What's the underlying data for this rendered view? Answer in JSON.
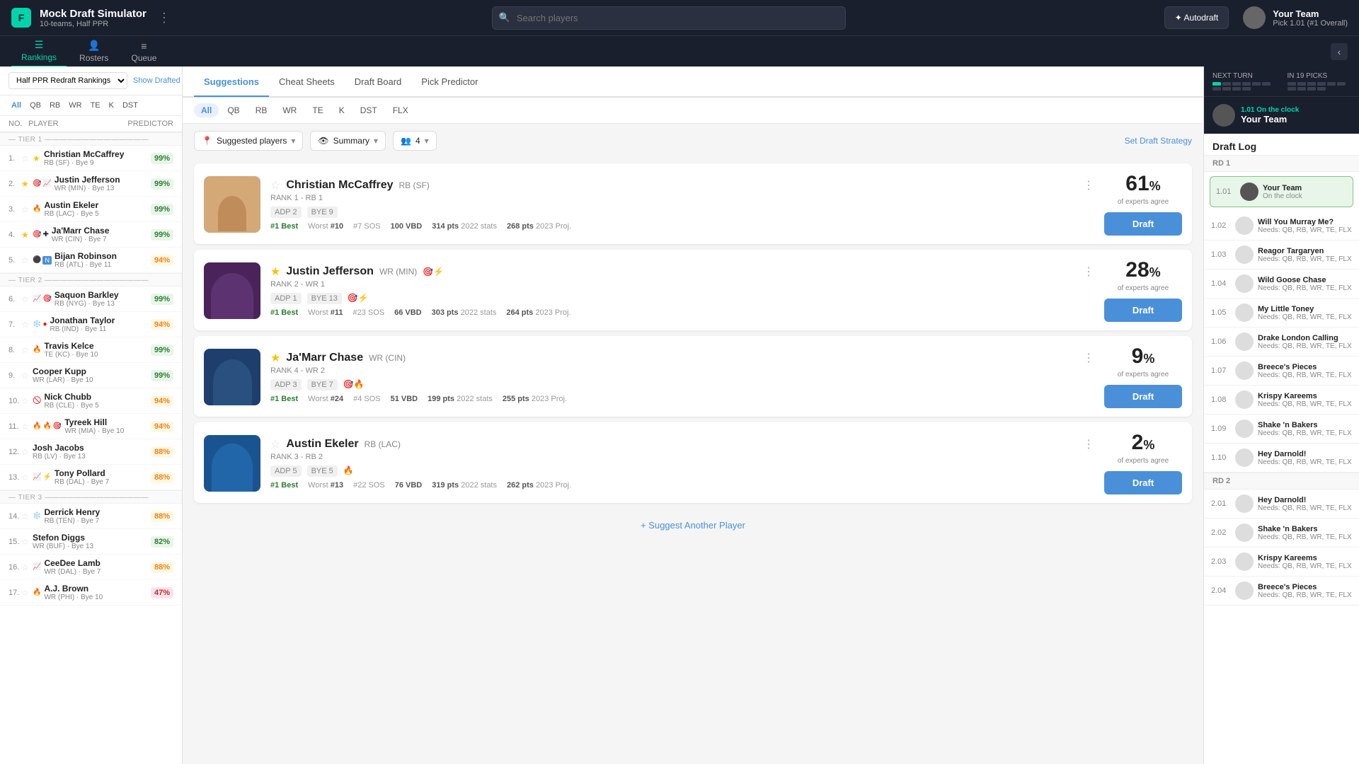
{
  "app": {
    "logo": "F",
    "title": "Mock Draft Simulator",
    "subtitle": "10-teams, Half PPR",
    "search_placeholder": "Search players",
    "autodraft_label": "✦ Autodraft",
    "your_team": {
      "name": "Your Team",
      "pick": "Pick 1.01 (#1 Overall)"
    }
  },
  "sub_nav": {
    "items": [
      {
        "id": "rankings",
        "label": "Rankings",
        "active": true
      },
      {
        "id": "rosters",
        "label": "Rosters",
        "active": false
      },
      {
        "id": "queue",
        "label": "Queue",
        "active": false
      }
    ]
  },
  "sidebar": {
    "ranking_select": "Half PPR Redraft Rankings",
    "show_drafted": "Show Drafted",
    "positions": [
      "All",
      "QB",
      "RB",
      "WR",
      "TE",
      "K",
      "DST"
    ],
    "active_position": "All",
    "table_header": {
      "no": "NO.",
      "player": "PLAYER",
      "predictor": "PREDICTOR"
    },
    "tiers": [
      {
        "label": "Tier 1",
        "players": [
          {
            "num": 1,
            "name": "Christian McCaffrey",
            "pos": "RB (SF)",
            "bye": "Bye 9",
            "score": 99,
            "starred": false,
            "icons": []
          },
          {
            "num": 2,
            "name": "Justin Jefferson",
            "pos": "WR (MIN)",
            "bye": "Bye 13",
            "score": 99,
            "starred": true,
            "icons": [
              "target",
              "trending-up"
            ]
          },
          {
            "num": 3,
            "name": "Austin Ekeler",
            "pos": "RB (LAC)",
            "bye": "Bye 5",
            "score": 99,
            "starred": false,
            "icons": [
              "fire"
            ]
          },
          {
            "num": 4,
            "name": "Ja'Marr Chase",
            "pos": "WR (CIN)",
            "bye": "Bye 7",
            "score": 99,
            "starred": false,
            "icons": [
              "target",
              "cross"
            ]
          },
          {
            "num": 5,
            "name": "Bijan Robinson",
            "pos": "RB (ATL)",
            "bye": "Bye 11",
            "score": 94,
            "starred": false,
            "icons": [
              "circle",
              "new"
            ]
          }
        ]
      },
      {
        "label": "Tier 2",
        "players": [
          {
            "num": 6,
            "name": "Saquon Barkley",
            "pos": "RB (NYG)",
            "bye": "Bye 13",
            "score": 99,
            "starred": false,
            "icons": [
              "up",
              "target"
            ]
          },
          {
            "num": 7,
            "name": "Jonathan Taylor",
            "pos": "RB (IND)",
            "bye": "Bye 11",
            "score": 94,
            "starred": false,
            "icons": [
              "snowflake",
              "dot-red"
            ]
          },
          {
            "num": 8,
            "name": "Travis Kelce",
            "pos": "TE (KC)",
            "bye": "Bye 10",
            "score": 99,
            "starred": false,
            "icons": [
              "fire"
            ]
          },
          {
            "num": 9,
            "name": "Cooper Kupp",
            "pos": "WR (LAR)",
            "bye": "Bye 10",
            "score": 99,
            "starred": false,
            "icons": []
          },
          {
            "num": 10,
            "name": "Nick Chubb",
            "pos": "RB (CLE)",
            "bye": "Bye 5",
            "score": 94,
            "starred": false,
            "icons": [
              "block"
            ]
          },
          {
            "num": 11,
            "name": "Tyreek Hill",
            "pos": "WR (MIA)",
            "bye": "Bye 10",
            "score": 94,
            "starred": false,
            "icons": [
              "fire",
              "fire",
              "target"
            ]
          },
          {
            "num": 12,
            "name": "Josh Jacobs",
            "pos": "RB (LV)",
            "bye": "Bye 13",
            "score": 88,
            "starred": false,
            "icons": []
          },
          {
            "num": 13,
            "name": "Tony Pollard",
            "pos": "RB (DAL)",
            "bye": "Bye 7",
            "score": 88,
            "starred": false,
            "icons": [
              "up",
              "trending"
            ]
          }
        ]
      },
      {
        "label": "Tier 3",
        "players": [
          {
            "num": 14,
            "name": "Derrick Henry",
            "pos": "RB (TEN)",
            "bye": "Bye 7",
            "score": 88,
            "starred": false,
            "icons": [
              "snowflake"
            ]
          },
          {
            "num": 15,
            "name": "Stefon Diggs",
            "pos": "WR (BUF)",
            "bye": "Bye 13",
            "score": 82,
            "starred": false,
            "icons": []
          },
          {
            "num": 16,
            "name": "CeeDee Lamb",
            "pos": "WR (DAL)",
            "bye": "Bye 7",
            "score": 88,
            "starred": false,
            "icons": [
              "up"
            ]
          },
          {
            "num": 17,
            "name": "A.J. Brown",
            "pos": "WR (PHI)",
            "bye": "Bye 10",
            "score": 47,
            "starred": false,
            "icons": [
              "fire"
            ]
          }
        ]
      }
    ]
  },
  "center": {
    "tabs": [
      {
        "id": "suggestions",
        "label": "Suggestions",
        "active": true
      },
      {
        "id": "cheat-sheets",
        "label": "Cheat Sheets",
        "active": false
      },
      {
        "id": "draft-board",
        "label": "Draft Board",
        "active": false
      },
      {
        "id": "pick-predictor",
        "label": "Pick Predictor",
        "active": false
      }
    ],
    "positions": [
      "All",
      "QB",
      "RB",
      "WR",
      "TE",
      "K",
      "DST",
      "FLX"
    ],
    "active_position": "All",
    "filter_suggested": "Suggested players",
    "filter_summary": "Summary",
    "filter_count": "4",
    "set_strategy": "Set Draft Strategy",
    "players": [
      {
        "id": "mccaffrey",
        "name": "Christian McCaffrey",
        "pos": "RB",
        "team": "SF",
        "rank_label": "RANK 1 - RB 1",
        "adp": "ADP 2",
        "bye": "BYE 9",
        "best": "#1 Best",
        "worst": "#10 Worst",
        "sos": "#7 SOS",
        "vbd": "100 VBD",
        "stats_2022": "314 pts",
        "proj_2023": "268 pts",
        "experts_pct": 61,
        "starred": false,
        "img_color": "#8B4513"
      },
      {
        "id": "jefferson",
        "name": "Justin Jefferson",
        "pos": "WR",
        "team": "MIN",
        "rank_label": "RANK 2 - WR 1",
        "adp": "ADP 1",
        "bye": "BYE 13",
        "best": "#1 Best",
        "worst": "#11 Worst",
        "sos": "#23 SOS",
        "vbd": "66 VBD",
        "stats_2022": "303 pts",
        "proj_2023": "264 pts",
        "experts_pct": 28,
        "starred": true,
        "img_color": "#4a235a"
      },
      {
        "id": "chase",
        "name": "Ja'Marr Chase",
        "pos": "WR",
        "team": "CIN",
        "rank_label": "RANK 4 - WR 2",
        "adp": "ADP 3",
        "bye": "BYE 7",
        "best": "#1 Best",
        "worst": "#24 Worst",
        "sos": "#4 SOS",
        "vbd": "51 VBD",
        "stats_2022": "199 pts",
        "proj_2023": "255 pts",
        "experts_pct": 9,
        "starred": true,
        "img_color": "#1a3a5c"
      },
      {
        "id": "ekeler",
        "name": "Austin Ekeler",
        "pos": "RB",
        "team": "LAC",
        "rank_label": "RANK 3 - RB 2",
        "adp": "ADP 5",
        "bye": "BYE 5",
        "best": "#1 Best",
        "worst": "#13 Worst",
        "sos": "#22 SOS",
        "vbd": "76 VBD",
        "stats_2022": "319 pts",
        "proj_2023": "262 pts",
        "experts_pct": 2,
        "starred": false,
        "img_color": "#1a4a7a"
      }
    ],
    "suggest_another": "+ Suggest Another Player"
  },
  "right_panel": {
    "next_turn_label": "NEXT TURN",
    "next_turn_picks": "IN 19 PICKS",
    "your_team_label": "Your Team",
    "on_the_clock": "1.01 On the clock",
    "draft_log_title": "Draft Log",
    "rounds": [
      {
        "label": "RD 1",
        "picks": [
          {
            "num": "1.01",
            "team": "Your Team",
            "needs": "On the clock",
            "highlighted": true
          },
          {
            "num": "1.02",
            "team": "Will You Murray Me?",
            "needs": "Needs: QB, RB, WR, TE, FLX"
          },
          {
            "num": "1.03",
            "team": "Reagor Targaryen",
            "needs": "Needs: QB, RB, WR, TE, FLX"
          },
          {
            "num": "1.04",
            "team": "Wild Goose Chase",
            "needs": "Needs: QB, RB, WR, TE, FLX"
          },
          {
            "num": "1.05",
            "team": "My Little Toney",
            "needs": "Needs: QB, RB, WR, TE, FLX"
          },
          {
            "num": "1.06",
            "team": "Drake London Calling",
            "needs": "Needs: QB, RB, WR, TE, FLX"
          },
          {
            "num": "1.07",
            "team": "Breece's Pieces",
            "needs": "Needs: QB, RB, WR, TE, FLX"
          },
          {
            "num": "1.08",
            "team": "Krispy Kareems",
            "needs": "Needs: QB, RB, WR, TE, FLX"
          },
          {
            "num": "1.09",
            "team": "Shake 'n Bakers",
            "needs": "Needs: QB, RB, WR, TE, FLX"
          },
          {
            "num": "1.10",
            "team": "Hey Darnold!",
            "needs": "Needs: QB, RB, WR, TE, FLX"
          }
        ]
      },
      {
        "label": "RD 2",
        "picks": [
          {
            "num": "2.01",
            "team": "Hey Darnold!",
            "needs": "Needs: QB, RB, WR, TE, FLX"
          },
          {
            "num": "2.02",
            "team": "Shake 'n Bakers",
            "needs": "Needs: QB, RB, WR, TE, FLX"
          },
          {
            "num": "2.03",
            "team": "Krispy Kareems",
            "needs": "Needs: QB, RB, WR, TE, FLX"
          },
          {
            "num": "2.04",
            "team": "Breece's Pieces",
            "needs": "Needs: QB, RB, WR, TE, FLX"
          }
        ]
      }
    ]
  }
}
